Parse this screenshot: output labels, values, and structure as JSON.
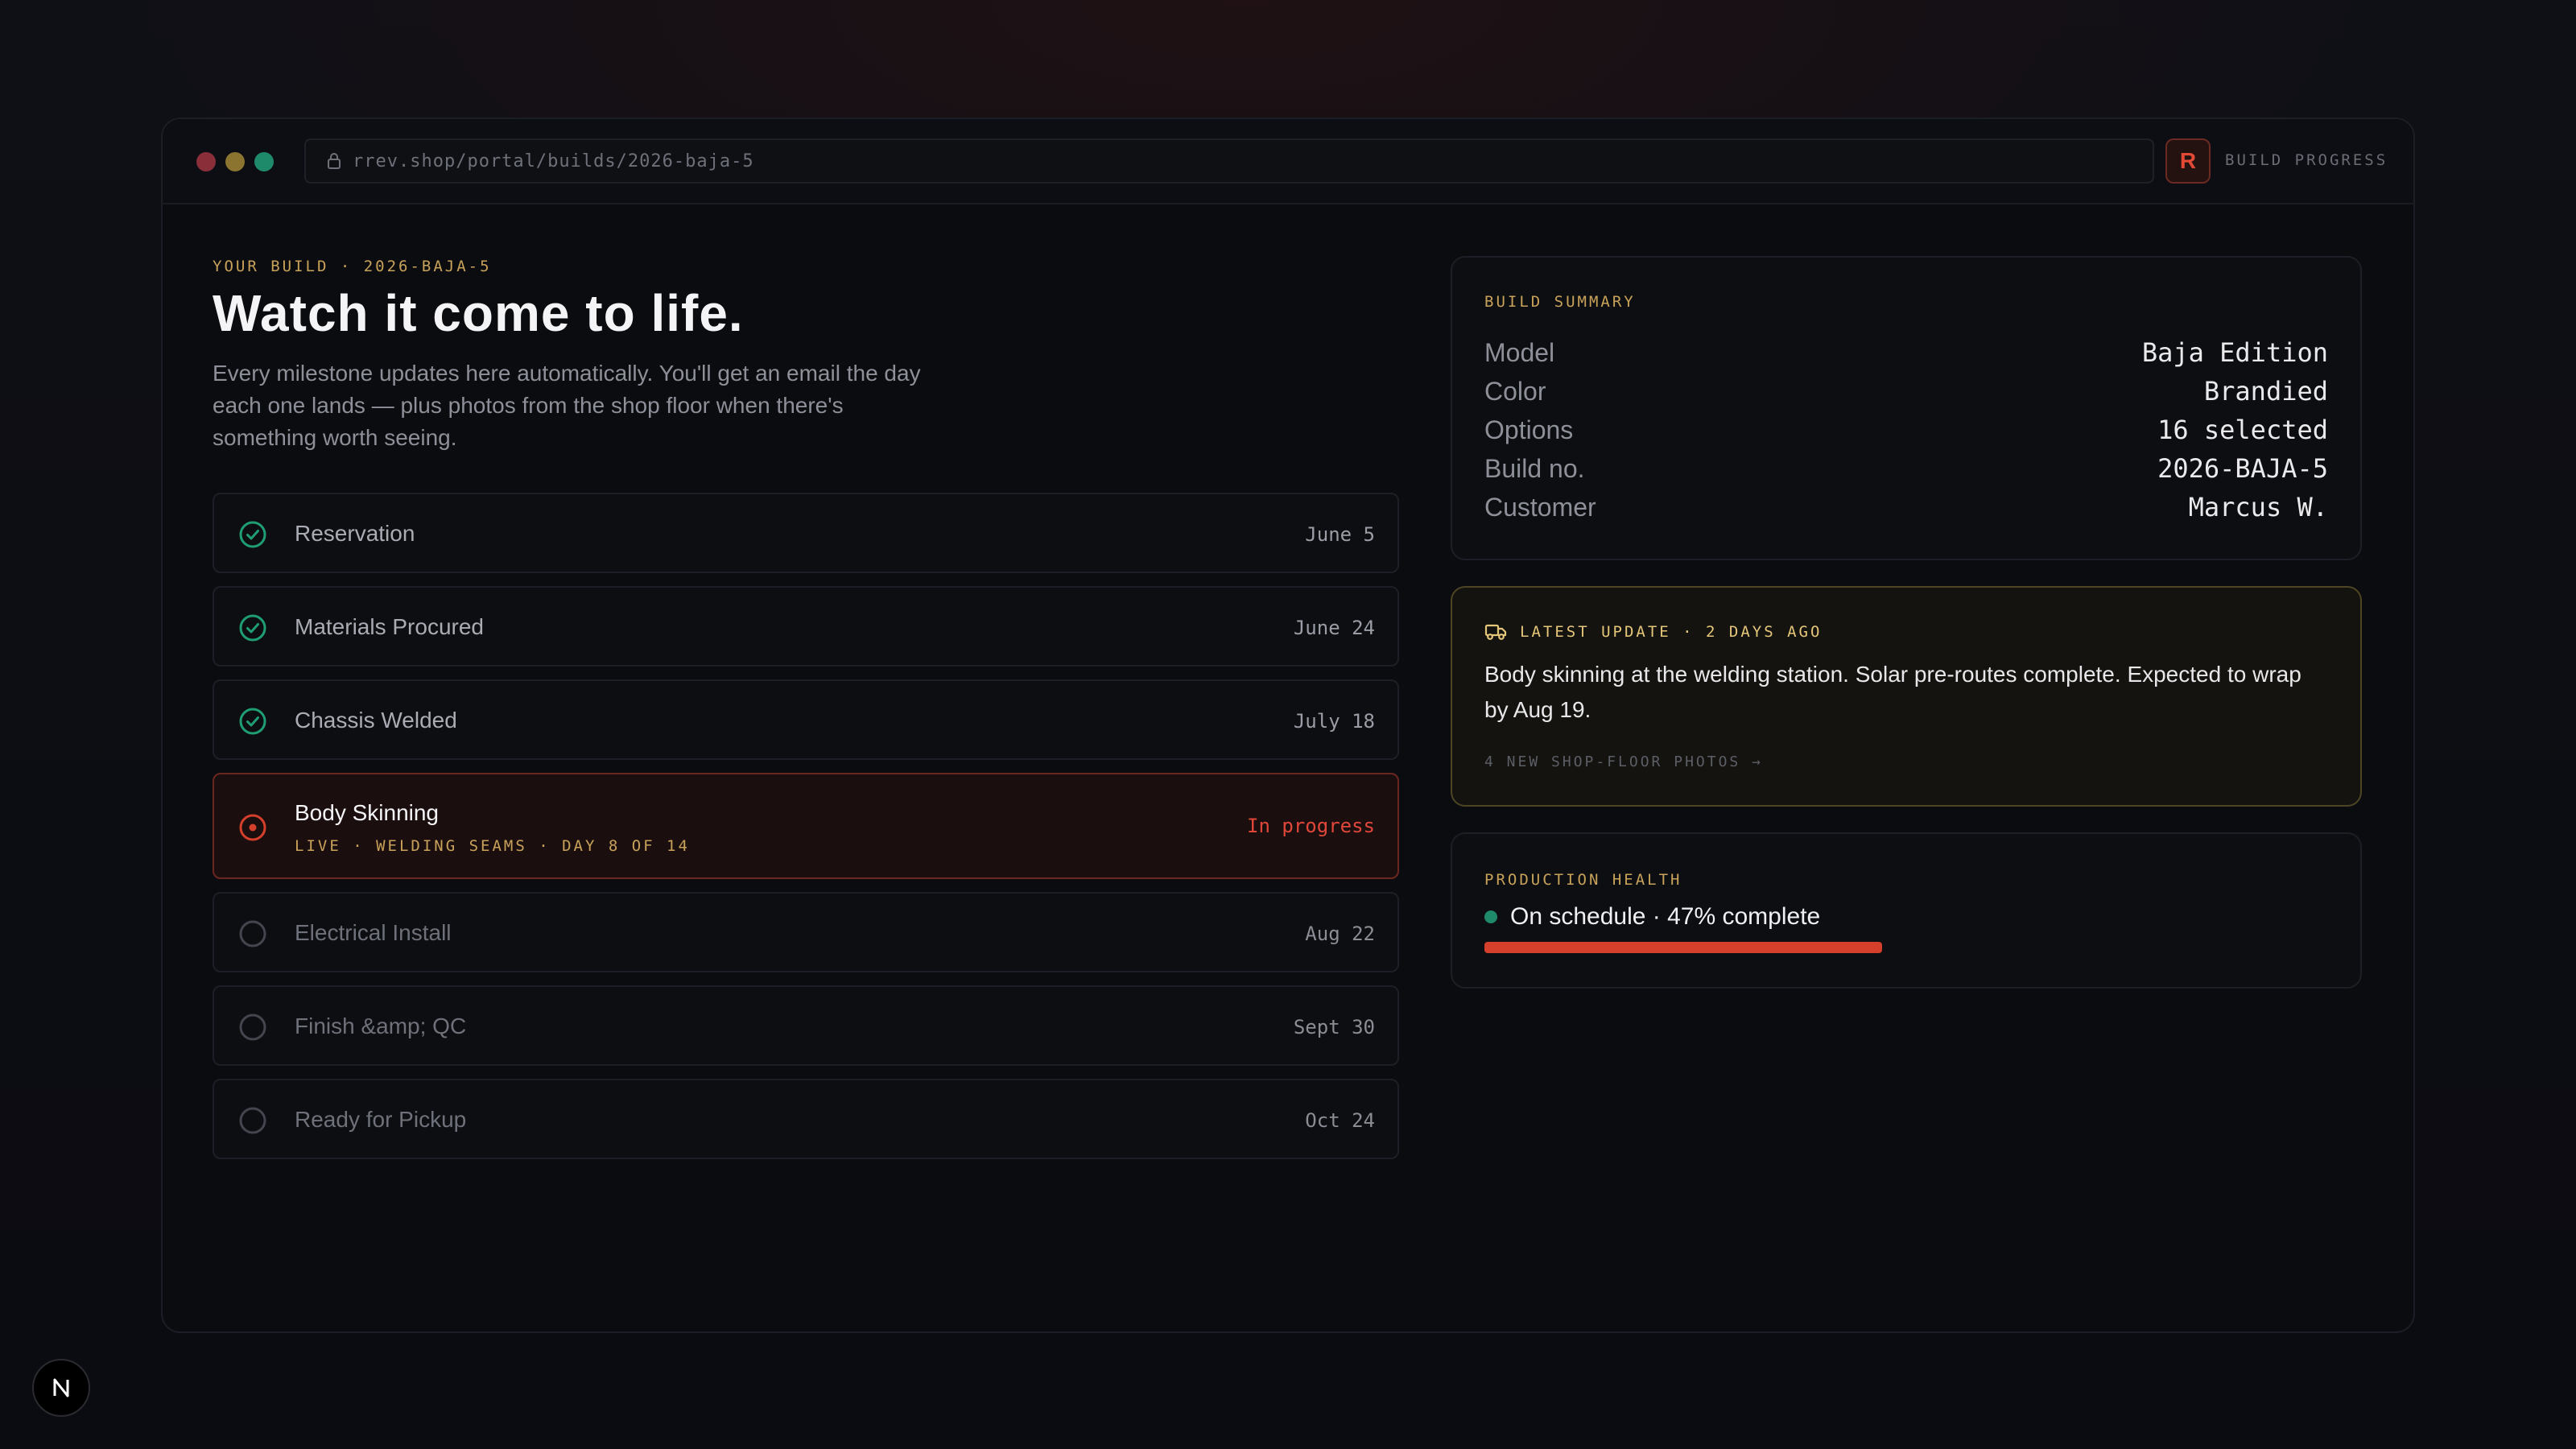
{
  "browser": {
    "url": "rrev.shop/portal/builds/2026-baja-5",
    "brand_letter": "R",
    "brand_label": "BUILD PROGRESS"
  },
  "hero": {
    "eyebrow": "YOUR BUILD · 2026-BAJA-5",
    "title": "Watch it come to life.",
    "intro": "Every milestone updates here automatically. You'll get an email the day each one lands — plus photos from the shop floor when there's something worth seeing."
  },
  "milestones": [
    {
      "title": "Reservation",
      "date": "June 5",
      "status": "done"
    },
    {
      "title": "Materials Procured",
      "date": "June 24",
      "status": "done"
    },
    {
      "title": "Chassis Welded",
      "date": "July 18",
      "status": "done"
    },
    {
      "title": "Body Skinning",
      "subtitle": "LIVE · WELDING SEAMS · DAY 8 OF 14",
      "date": "In progress",
      "status": "active"
    },
    {
      "title": "Electrical Install",
      "date": "Aug 22",
      "status": "pending"
    },
    {
      "title": "Finish &amp; QC",
      "date": "Sept 30",
      "status": "pending"
    },
    {
      "title": "Ready for Pickup",
      "date": "Oct 24",
      "status": "pending"
    }
  ],
  "summary": {
    "label": "BUILD SUMMARY",
    "rows": [
      {
        "key": "Model",
        "value": "Baja Edition"
      },
      {
        "key": "Color",
        "value": "Brandied"
      },
      {
        "key": "Options",
        "value": "16 selected"
      },
      {
        "key": "Build no.",
        "value": "2026-BAJA-5"
      },
      {
        "key": "Customer",
        "value": "Marcus W."
      }
    ]
  },
  "latest_update": {
    "label": "LATEST UPDATE · 2 DAYS AGO",
    "body": "Body skinning at the welding station. Solar pre-routes complete. Expected to wrap by Aug 19.",
    "link": "4 NEW SHOP-FLOOR PHOTOS →"
  },
  "health": {
    "label": "PRODUCTION HEALTH",
    "status": "On schedule · 47% complete",
    "progress": 0.47
  },
  "colors": {
    "accent_red": "#d4402c",
    "accent_gold": "#c9a25a",
    "success_green": "#1f8a6a"
  },
  "icons": {
    "done": "check-circle-icon",
    "active": "radio-dot-icon",
    "pending": "empty-circle-icon"
  }
}
